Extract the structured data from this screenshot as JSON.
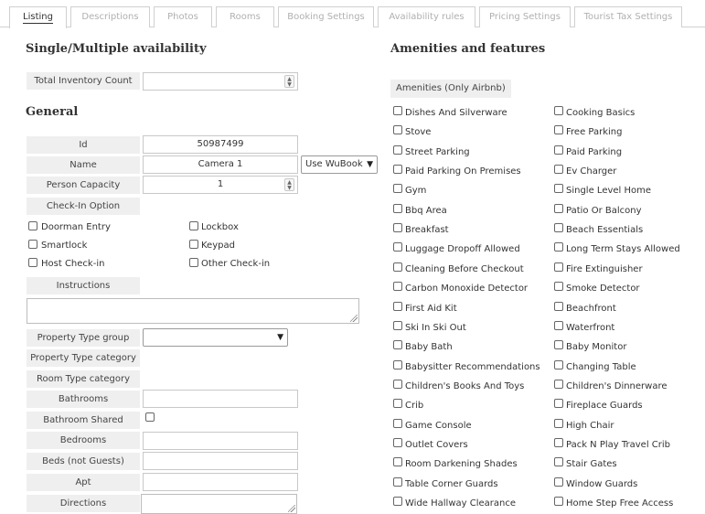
{
  "tabs": [
    {
      "label": "Listing",
      "active": true
    },
    {
      "label": "Descriptions",
      "active": false
    },
    {
      "label": "Photos",
      "active": false
    },
    {
      "label": "Rooms",
      "active": false
    },
    {
      "label": "Booking Settings",
      "active": false
    },
    {
      "label": "Availability rules",
      "active": false
    },
    {
      "label": "Pricing Settings",
      "active": false
    },
    {
      "label": "Tourist Tax Settings",
      "active": false
    }
  ],
  "availability": {
    "title": "Single/Multiple availability",
    "total_inventory_label": "Total Inventory Count",
    "total_inventory_value": ""
  },
  "general": {
    "title": "General",
    "id_label": "Id",
    "id_value": "50987499",
    "name_label": "Name",
    "name_value": "Camera 1",
    "name_source_select": "Use WuBook",
    "person_capacity_label": "Person Capacity",
    "person_capacity_value": "1",
    "checkin_option_label": "Check-In Option",
    "checkin_options": [
      {
        "label": "Doorman Entry",
        "checked": false
      },
      {
        "label": "Lockbox",
        "checked": false
      },
      {
        "label": "Smartlock",
        "checked": false
      },
      {
        "label": "Keypad",
        "checked": false
      },
      {
        "label": "Host Check-in",
        "checked": false
      },
      {
        "label": "Other Check-in",
        "checked": false
      }
    ],
    "instructions_label": "Instructions",
    "instructions_value": "",
    "property_type_group_label": "Property Type group",
    "property_type_group_value": "",
    "property_type_category_label": "Property Type category",
    "room_type_category_label": "Room Type category",
    "bathrooms_label": "Bathrooms",
    "bathrooms_value": "",
    "bathroom_shared_label": "Bathroom Shared",
    "bedrooms_label": "Bedrooms",
    "bedrooms_value": "",
    "beds_label": "Beds (not Guests)",
    "beds_value": "",
    "apt_label": "Apt",
    "apt_value": "",
    "directions_label": "Directions",
    "directions_value": ""
  },
  "amenities": {
    "title": "Amenities and features",
    "group_label": "Amenities (Only Airbnb)",
    "left": [
      "Dishes And Silverware",
      "Stove",
      "Street Parking",
      "Paid Parking On Premises",
      "Gym",
      "Bbq Area",
      "Breakfast",
      "Luggage Dropoff Allowed",
      "Cleaning Before Checkout",
      "Carbon Monoxide Detector",
      "First Aid Kit",
      "Ski In Ski Out",
      "Baby Bath",
      "Babysitter Recommendations",
      "Children's Books And Toys",
      "Crib",
      "Game Console",
      "Outlet Covers",
      "Room Darkening Shades",
      "Table Corner Guards",
      "Wide Hallway Clearance"
    ],
    "right": [
      "Cooking Basics",
      "Free Parking",
      "Paid Parking",
      "Ev Charger",
      "Single Level Home",
      "Patio Or Balcony",
      "Beach Essentials",
      "Long Term Stays Allowed",
      "Fire Extinguisher",
      "Smoke Detector",
      "Beachfront",
      "Waterfront",
      "Baby Monitor",
      "Changing Table",
      "Children's Dinnerware",
      "Fireplace Guards",
      "High Chair",
      "Pack N Play Travel Crib",
      "Stair Gates",
      "Window Guards",
      "Home Step Free Access"
    ]
  },
  "colors": {
    "label_bg": "#efefef",
    "border": "#c8c8c8",
    "tab_inactive_text": "#b0b0b0"
  }
}
